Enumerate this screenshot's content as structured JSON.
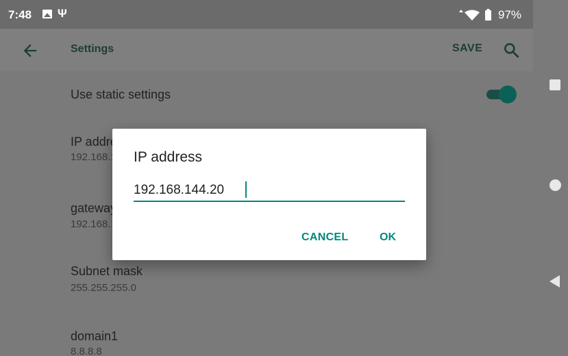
{
  "status_bar": {
    "time": "7:48",
    "usb_symbol": "Ψ",
    "battery_percent": "97%",
    "icons": [
      "image-icon",
      "usb-icon",
      "data-arrows-icon",
      "wifi-icon",
      "battery-icon"
    ]
  },
  "app_bar": {
    "title": "Settings",
    "save_label": "SAVE",
    "icons": [
      "back-arrow-icon",
      "search-icon"
    ]
  },
  "settings": {
    "static": {
      "label": "Use static settings",
      "enabled": true
    },
    "ip": {
      "label": "IP address",
      "value": "192.168.144.20"
    },
    "gateway": {
      "label": "gateway",
      "value": "192.168.144.1"
    },
    "subnet": {
      "label": "Subnet mask",
      "value": "255.255.255.0"
    },
    "domain": {
      "label": "domain1",
      "value": "8.8.8.8"
    }
  },
  "dialog": {
    "title": "IP address",
    "input_value": "192.168.144.20",
    "cancel_label": "CANCEL",
    "ok_label": "OK"
  },
  "nav_bar": {
    "icons": [
      "recents-square-icon",
      "home-circle-icon",
      "back-triangle-icon"
    ]
  },
  "colors": {
    "accent": "#00897b",
    "toggle_on": "#0b6157",
    "statusbar": "#6b6b6b"
  }
}
